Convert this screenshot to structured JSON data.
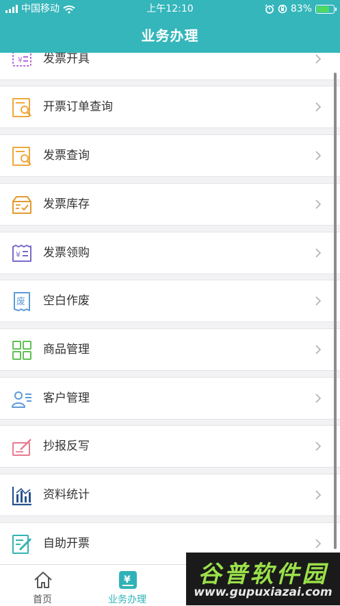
{
  "status_bar": {
    "carrier": "中国移动",
    "time": "上午12:10",
    "battery_percent": "83%",
    "battery_level": 0.83
  },
  "header": {
    "title": "业务办理"
  },
  "menu": [
    {
      "label": "发票开具",
      "icon": "invoice-issue-icon"
    },
    {
      "label": "开票订单查询",
      "icon": "order-search-icon"
    },
    {
      "label": "发票查询",
      "icon": "invoice-search-icon"
    },
    {
      "label": "发票库存",
      "icon": "inventory-box-icon"
    },
    {
      "label": "发票领购",
      "icon": "invoice-purchase-icon"
    },
    {
      "label": "空白作废",
      "icon": "void-icon"
    },
    {
      "label": "商品管理",
      "icon": "grid-icon"
    },
    {
      "label": "客户管理",
      "icon": "contact-card-icon"
    },
    {
      "label": "抄报反写",
      "icon": "edit-pen-icon"
    },
    {
      "label": "资料统计",
      "icon": "bar-chart-icon"
    },
    {
      "label": "自助开票",
      "icon": "self-service-edit-icon"
    }
  ],
  "tabs": [
    {
      "label": "首页",
      "icon": "home-icon"
    },
    {
      "label": "业务办理",
      "icon": "yen-icon"
    }
  ],
  "watermark": {
    "line1": "谷普软件园",
    "line2": "www.gupuxiazai.com"
  },
  "colors": {
    "brand": "#34b6bb",
    "tab_active": "#2fb2b7",
    "icon_orange": "#f0a63a",
    "icon_purple": "#7b69c8",
    "icon_blue": "#5b9bd8",
    "icon_green": "#5fc153",
    "icon_pink": "#e87a8e",
    "icon_navy": "#27518f",
    "icon_teal": "#33b3b3"
  }
}
